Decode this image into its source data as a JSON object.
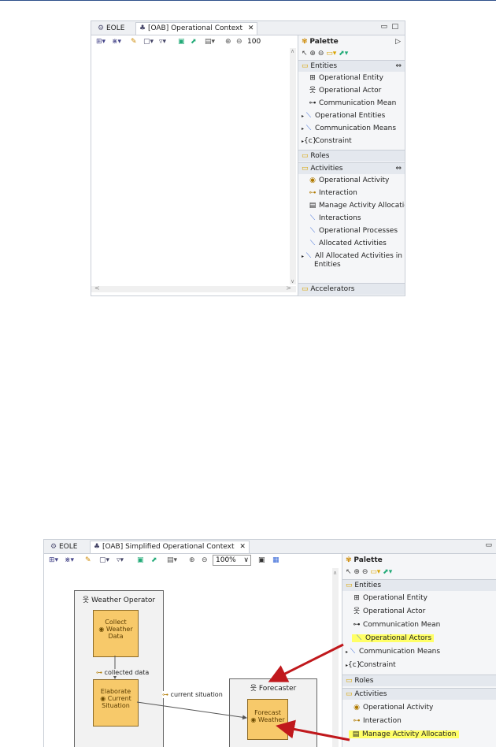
{
  "top_window": {
    "tab_eole": "EOLE",
    "tab_diagram": "[OAB] Operational Context",
    "zoom_clip": "100",
    "palette": {
      "title": "Palette",
      "drawers": {
        "entities": "Entities",
        "roles": "Roles",
        "activities": "Activities",
        "accelerators": "Accelerators"
      },
      "entities_items": [
        "Operational Entity",
        "Operational Actor",
        "Communication Mean",
        "Operational Entities",
        "Communication Means",
        "Constraint"
      ],
      "activities_items": [
        "Operational Activity",
        "Interaction",
        "Manage Activity Allocation",
        "Interactions",
        "Operational Processes",
        "Allocated Activities",
        "All Allocated Activities in",
        "Entities"
      ]
    }
  },
  "bottom_window": {
    "tab_eole": "EOLE",
    "tab_diagram": "[OAB] Simplified Operational Context",
    "zoom": "100%",
    "palette": {
      "title": "Palette",
      "drawers": {
        "entities": "Entities",
        "roles": "Roles",
        "activities": "Activities"
      },
      "entities_items": [
        "Operational Entity",
        "Operational Actor",
        "Communication Mean",
        "Operational Actors",
        "Communication Means",
        "Constraint"
      ],
      "activities_items": [
        "Operational Activity",
        "Interaction",
        "Manage Activity Allocation"
      ]
    },
    "diagram": {
      "group_weather_operator": "Weather Operator",
      "group_forecaster": "Forecaster",
      "node_collect": [
        "Collect",
        "Weather",
        "Data"
      ],
      "node_elaborate": [
        "Elaborate",
        "Current",
        "Situation"
      ],
      "node_forecast": [
        "Forecast",
        "Weather"
      ],
      "edge_collected": "collected data",
      "edge_current": "current situation"
    }
  },
  "colors": {
    "highlight": "#ffff66",
    "arrow": "#c0181c",
    "node_fill": "#f7c96a"
  }
}
